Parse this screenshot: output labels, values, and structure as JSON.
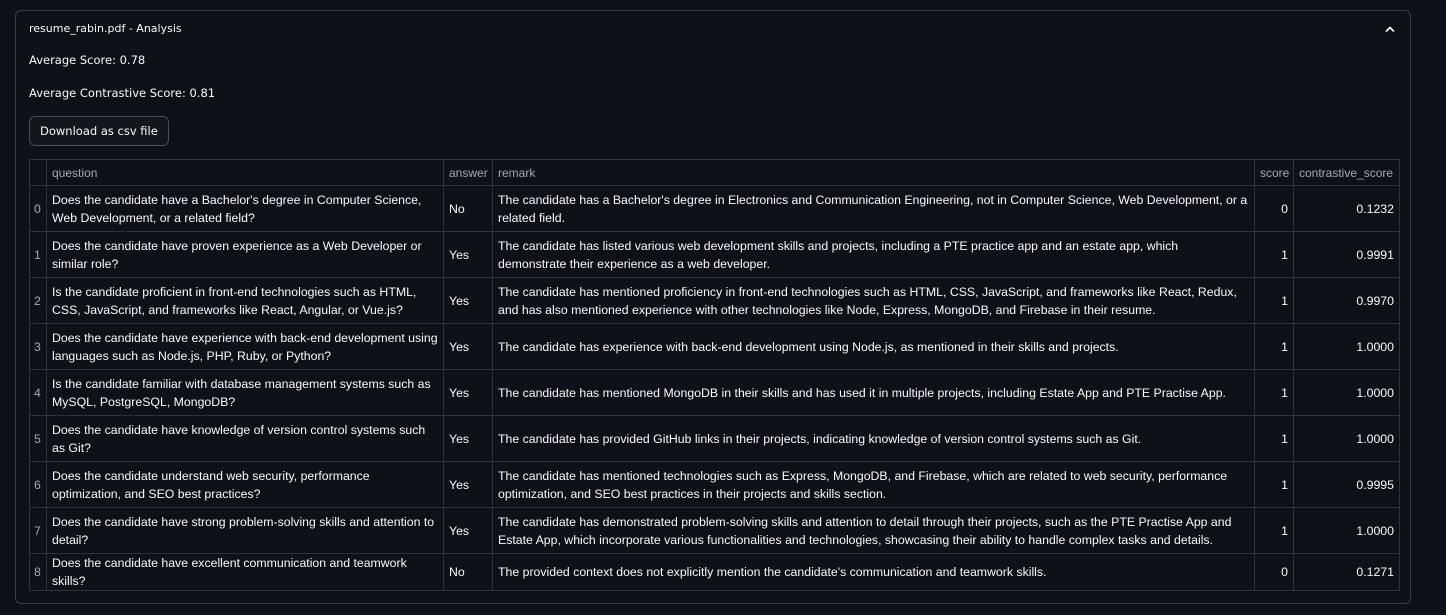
{
  "expander": {
    "title": "resume_rabin.pdf - Analysis"
  },
  "metrics": {
    "average_score": "Average Score: 0.78",
    "average_contrastive_score": "Average Contrastive Score: 0.81"
  },
  "download_button": {
    "label": "Download as csv file"
  },
  "table": {
    "columns": [
      "",
      "question",
      "answer",
      "remark",
      "score",
      "contrastive_score"
    ],
    "rows": [
      {
        "index": "0",
        "question": "Does the candidate have a Bachelor's degree in Computer Science, Web Development, or a related field?",
        "answer": "No",
        "remark": "The candidate has a Bachelor's degree in Electronics and Communication Engineering, not in Computer Science, Web Development, or a related field.",
        "score": "0",
        "contrastive_score": "0.1232"
      },
      {
        "index": "1",
        "question": "Does the candidate have proven experience as a Web Developer or similar role?",
        "answer": "Yes",
        "remark": "The candidate has listed various web development skills and projects, including a PTE practice app and an estate app, which demonstrate their experience as a web developer.",
        "score": "1",
        "contrastive_score": "0.9991"
      },
      {
        "index": "2",
        "question": "Is the candidate proficient in front-end technologies such as HTML, CSS, JavaScript, and frameworks like React, Angular, or Vue.js?",
        "answer": "Yes",
        "remark": "The candidate has mentioned proficiency in front-end technologies such as HTML, CSS, JavaScript, and frameworks like React, Redux, and has also mentioned experience with other technologies like Node, Express, MongoDB, and Firebase in their resume.",
        "score": "1",
        "contrastive_score": "0.9970"
      },
      {
        "index": "3",
        "question": "Does the candidate have experience with back-end development using languages such as Node.js, PHP, Ruby, or Python?",
        "answer": "Yes",
        "remark": "The candidate has experience with back-end development using Node.js, as mentioned in their skills and projects.",
        "score": "1",
        "contrastive_score": "1.0000"
      },
      {
        "index": "4",
        "question": "Is the candidate familiar with database management systems such as MySQL, PostgreSQL, MongoDB?",
        "answer": "Yes",
        "remark": "The candidate has mentioned MongoDB in their skills and has used it in multiple projects, including Estate App and PTE Practise App.",
        "score": "1",
        "contrastive_score": "1.0000"
      },
      {
        "index": "5",
        "question": "Does the candidate have knowledge of version control systems such as Git?",
        "answer": "Yes",
        "remark": "The candidate has provided GitHub links in their projects, indicating knowledge of version control systems such as Git.",
        "score": "1",
        "contrastive_score": "1.0000"
      },
      {
        "index": "6",
        "question": "Does the candidate understand web security, performance optimization, and SEO best practices?",
        "answer": "Yes",
        "remark": "The candidate has mentioned technologies such as Express, MongoDB, and Firebase, which are related to web security, performance optimization, and SEO best practices in their projects and skills section.",
        "score": "1",
        "contrastive_score": "0.9995"
      },
      {
        "index": "7",
        "question": "Does the candidate have strong problem-solving skills and attention to detail?",
        "answer": "Yes",
        "remark": "The candidate has demonstrated problem-solving skills and attention to detail through their projects, such as the PTE Practise App and Estate App, which incorporate various functionalities and technologies, showcasing their ability to handle complex tasks and details.",
        "score": "1",
        "contrastive_score": "1.0000"
      },
      {
        "index": "8",
        "question": "Does the candidate have excellent communication and teamwork skills?",
        "answer": "No",
        "remark": "The provided context does not explicitly mention the candidate's communication and teamwork skills.",
        "score": "0",
        "contrastive_score": "0.1271"
      }
    ]
  },
  "icons": {
    "collapse": "chevron-up-icon"
  },
  "colors": {
    "background": "#0e1117",
    "border": "#3a3d45",
    "text": "#fafafa",
    "muted_text": "#a3a8b4"
  }
}
